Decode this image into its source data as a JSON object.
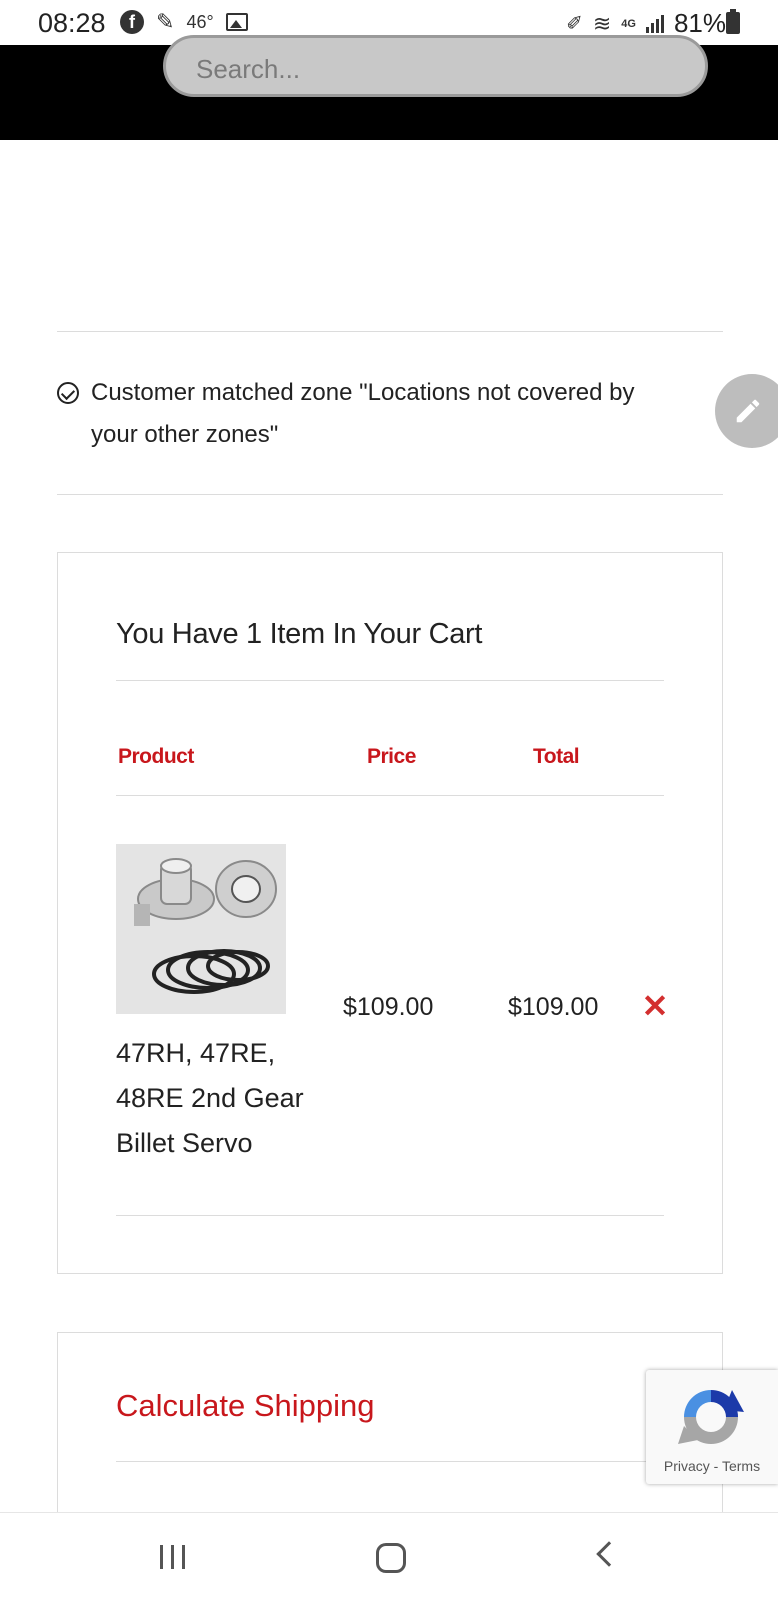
{
  "status_bar": {
    "time": "08:28",
    "temperature": "46°",
    "battery": "81%",
    "network": "4G"
  },
  "header": {
    "search_placeholder": "Search..."
  },
  "notice": {
    "text": "Customer matched zone \"Locations not covered by your other zones\""
  },
  "cart": {
    "title": "You Have 1 Item In Your Cart",
    "columns": {
      "product": "Product",
      "price": "Price",
      "total": "Total"
    },
    "items": [
      {
        "name": " 47RH, 47RE, 48RE 2nd Gear Billet Servo",
        "price": "$109.00",
        "total": "$109.00",
        "remove_icon": "close-icon"
      }
    ]
  },
  "shipping": {
    "title": "Calculate Shipping"
  },
  "recaptcha": {
    "privacy": "Privacy",
    "separator": " - ",
    "terms": "Terms"
  },
  "colors": {
    "accent": "#c8171c",
    "remove": "#d32f2f",
    "header_bg": "#000000"
  }
}
